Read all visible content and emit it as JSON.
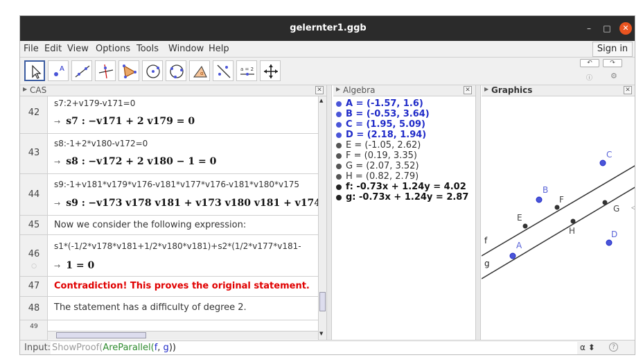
{
  "window": {
    "title": "gelernter1.ggb"
  },
  "menu": {
    "items": [
      "File",
      "Edit",
      "View",
      "Options",
      "Tools",
      "Window",
      "Help"
    ],
    "sign_in": "Sign in"
  },
  "toolbar": {
    "tools": [
      "move-tool",
      "point-tool",
      "line-tool",
      "perpendicular-line-tool",
      "polygon-tool",
      "circle-center-point-tool",
      "circle-three-points-tool",
      "angle-tool",
      "reflect-about-line-tool",
      "slider-tool",
      "move-graphics-view-tool"
    ],
    "slider_label": "a = 2"
  },
  "cas": {
    "header": "CAS",
    "rows": [
      {
        "num": "42",
        "input": "s7:2+v179-v171=0",
        "out_name": "s7 :",
        "out_expr": "−v171 + 2 v179 = 0"
      },
      {
        "num": "43",
        "input": "s8:-1+2*v180-v172=0",
        "out_name": "s8 :",
        "out_expr": "−v172 + 2 v180 − 1 = 0"
      },
      {
        "num": "44",
        "input": "s9:-1+v181*v179*v176-v181*v177*v176-v181*v180*v175",
        "out_name": "s9 :",
        "out_expr": "−v173 v178 v181 + v173 v180 v181 + v174 v1"
      },
      {
        "num": "45",
        "text": "Now we consider the following expression:"
      },
      {
        "num": "46",
        "input": "s1*(-1/2*v178*v181+1/2*v180*v181)+s2*(1/2*v177*v181-",
        "out_expr": "1 = 0"
      },
      {
        "num": "47",
        "text": "Contradiction! This proves the original statement."
      },
      {
        "num": "48",
        "text": "The statement has a difficulty of degree 2."
      },
      {
        "num": "49"
      }
    ]
  },
  "algebra": {
    "header": "Algebra",
    "items": [
      "A = (-1.57, 1.6)",
      "B = (-0.53, 3.64)",
      "C = (1.95, 5.09)",
      "D = (2.18, 1.94)",
      "E = (-1.05, 2.62)",
      "F = (0.19, 3.35)",
      "G = (2.07, 3.52)",
      "H = (0.82, 2.79)",
      "f: -0.73x + 1.24y = 4.02",
      "g: -0.73x + 1.24y = 2.87"
    ]
  },
  "graphics": {
    "header": "Graphics",
    "labels": {
      "A": "A",
      "B": "B",
      "C": "C",
      "D": "D",
      "E": "E",
      "F": "F",
      "G": "G",
      "H": "H",
      "f": "f",
      "g": "g"
    }
  },
  "input_bar": {
    "label": "Input:",
    "cmd_outer": "ShowProof(",
    "cmd_inner": "AreParallel(",
    "arg1": "f",
    "sep": ", ",
    "arg2": "g",
    "close": "))",
    "alpha": "α"
  },
  "colors": {
    "free_point": "#1f2ac8",
    "point_fill": "#4a55d8",
    "red_text": "#e00000",
    "close_button": "#e95420"
  }
}
